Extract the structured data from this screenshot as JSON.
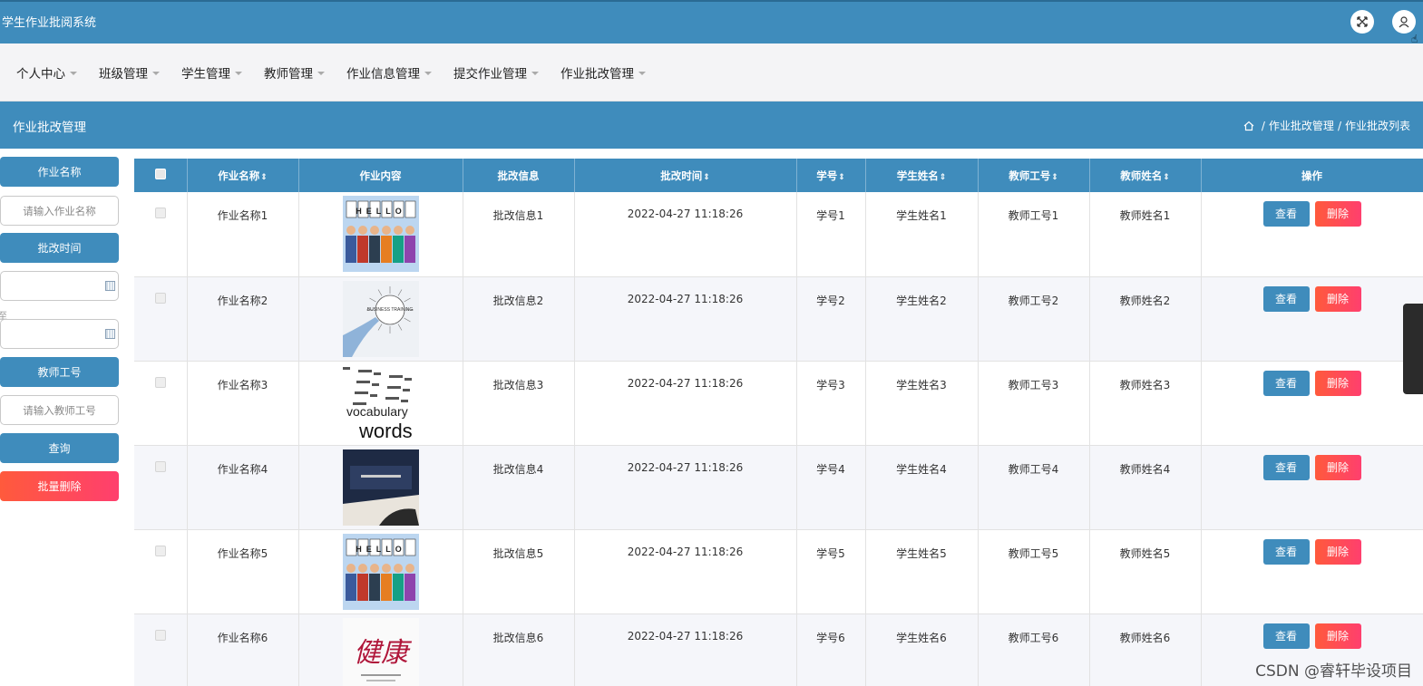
{
  "app": {
    "title": "学生作业批阅系统"
  },
  "nav": {
    "items": [
      "个人中心",
      "班级管理",
      "学生管理",
      "教师管理",
      "作业信息管理",
      "提交作业管理",
      "作业批改管理"
    ]
  },
  "page": {
    "title": "作业批改管理",
    "breadcrumb": [
      "作业批改管理",
      "作业批改列表"
    ],
    "breadcrumb_sep": "/"
  },
  "search": {
    "name_label": "作业名称",
    "name_placeholder": "请输入作业名称",
    "time_label": "批改时间",
    "time_sep": "至",
    "teacher_label": "教师工号",
    "teacher_placeholder": "请输入教师工号",
    "query_button": "查询",
    "batch_delete_button": "批量删除"
  },
  "table": {
    "columns": [
      "作业名称",
      "作业内容",
      "批改信息",
      "批改时间",
      "学号",
      "学生姓名",
      "教师工号",
      "教师姓名",
      "操作"
    ],
    "sort_symbol": "⇕",
    "view_label": "查看",
    "delete_label": "删除",
    "rows": [
      {
        "name": "作业名称1",
        "image": "hello",
        "info": "批改信息1",
        "time": "2022-04-27 11:18:26",
        "student_no": "学号1",
        "student_name": "学生姓名1",
        "teacher_no": "教师工号1",
        "teacher_name": "教师姓名1"
      },
      {
        "name": "作业名称2",
        "image": "training",
        "info": "批改信息2",
        "time": "2022-04-27 11:18:26",
        "student_no": "学号2",
        "student_name": "学生姓名2",
        "teacher_no": "教师工号2",
        "teacher_name": "教师姓名2"
      },
      {
        "name": "作业名称3",
        "image": "words",
        "info": "批改信息3",
        "time": "2022-04-27 11:18:26",
        "student_no": "学号3",
        "student_name": "学生姓名3",
        "teacher_no": "教师工号3",
        "teacher_name": "教师姓名3"
      },
      {
        "name": "作业名称4",
        "image": "book",
        "info": "批改信息4",
        "time": "2022-04-27 11:18:26",
        "student_no": "学号4",
        "student_name": "学生姓名4",
        "teacher_no": "教师工号4",
        "teacher_name": "教师姓名4"
      },
      {
        "name": "作业名称5",
        "image": "hello",
        "info": "批改信息5",
        "time": "2022-04-27 11:18:26",
        "student_no": "学号5",
        "student_name": "学生姓名5",
        "teacher_no": "教师工号5",
        "teacher_name": "教师姓名5"
      },
      {
        "name": "作业名称6",
        "image": "calligraphy",
        "info": "批改信息6",
        "time": "2022-04-27 11:18:26",
        "student_no": "学号6",
        "student_name": "学生姓名6",
        "teacher_no": "教师工号6",
        "teacher_name": "教师姓名6"
      }
    ]
  },
  "thumb_text": {
    "hello": "HELLO",
    "training": "BUSINESS TRAINING",
    "words": "vocabulary words",
    "calligraphy": "健康"
  },
  "icons": {
    "fullscreen": "expand-icon",
    "user": "user-icon",
    "home": "home-icon",
    "calendar": "calendar-icon"
  },
  "watermark": "CSDN @睿轩毕设项目",
  "colors": {
    "primary": "#3f8cbc",
    "danger": "#ff4a52"
  }
}
